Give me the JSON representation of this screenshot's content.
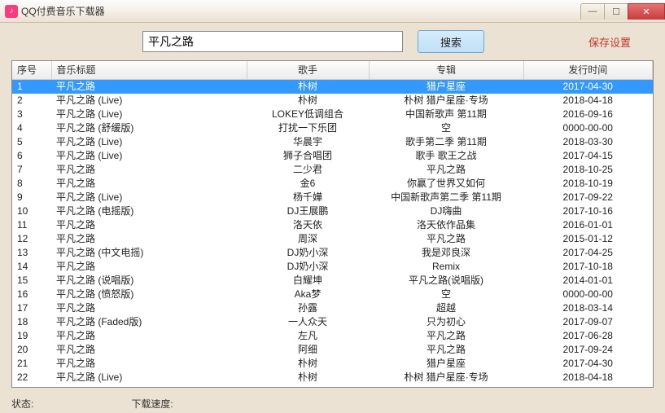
{
  "window": {
    "title": "QQ付费音乐下载器",
    "icon_glyph": "♪"
  },
  "win_controls": {
    "min": "—",
    "max": "☐",
    "close": "✕"
  },
  "search": {
    "value": "平凡之路",
    "button": "搜索",
    "save_link": "保存设置"
  },
  "table": {
    "headers": [
      "序号",
      "音乐标题",
      "歌手",
      "专辑",
      "发行时间"
    ],
    "rows": [
      {
        "n": "1",
        "title": "平凡之路",
        "artist": "朴树",
        "album": "猎户星座",
        "date": "2017-04-30",
        "sel": true
      },
      {
        "n": "2",
        "title": "平凡之路 (Live)",
        "artist": "朴树",
        "album": "朴树 猎户星座·专场",
        "date": "2018-04-18"
      },
      {
        "n": "3",
        "title": "平凡之路 (Live)",
        "artist": "LOKEY低调组合",
        "album": "中国新歌声 第11期",
        "date": "2016-09-16"
      },
      {
        "n": "4",
        "title": "平凡之路 (舒缓版)",
        "artist": "打扰一下乐团",
        "album": "空",
        "date": "0000-00-00"
      },
      {
        "n": "5",
        "title": "平凡之路 (Live)",
        "artist": "华晨宇",
        "album": "歌手第二季 第11期",
        "date": "2018-03-30"
      },
      {
        "n": "6",
        "title": "平凡之路 (Live)",
        "artist": "狮子合唱团",
        "album": "歌手 歌王之战",
        "date": "2017-04-15"
      },
      {
        "n": "7",
        "title": "平凡之路",
        "artist": "二少君",
        "album": "平凡之路",
        "date": "2018-10-25"
      },
      {
        "n": "8",
        "title": "平凡之路",
        "artist": "金6",
        "album": "你赢了世界又如何",
        "date": "2018-10-19"
      },
      {
        "n": "9",
        "title": "平凡之路 (Live)",
        "artist": "杨千嬅",
        "album": "中国新歌声第二季 第11期",
        "date": "2017-09-22"
      },
      {
        "n": "10",
        "title": "平凡之路 (电摇版)",
        "artist": "DJ王展鹏",
        "album": "DJ嗨曲",
        "date": "2017-10-16"
      },
      {
        "n": "11",
        "title": "平凡之路",
        "artist": "洛天依",
        "album": "洛天依作品集",
        "date": "2016-01-01"
      },
      {
        "n": "12",
        "title": "平凡之路",
        "artist": "周深",
        "album": "平凡之路",
        "date": "2015-01-12"
      },
      {
        "n": "13",
        "title": "平凡之路 (中文电摇)",
        "artist": "DJ奶小深",
        "album": "我是邓良深",
        "date": "2017-04-25"
      },
      {
        "n": "14",
        "title": "平凡之路",
        "artist": "DJ奶小深",
        "album": "Remix",
        "date": "2017-10-18"
      },
      {
        "n": "15",
        "title": "平凡之路 (说唱版)",
        "artist": "白耀坤",
        "album": "平凡之路(说唱版)",
        "date": "2014-01-01"
      },
      {
        "n": "16",
        "title": "平凡之路 (愤怒版)",
        "artist": "Aka梦",
        "album": "空",
        "date": "0000-00-00"
      },
      {
        "n": "17",
        "title": "平凡之路",
        "artist": "孙露",
        "album": "超越",
        "date": "2018-03-14"
      },
      {
        "n": "18",
        "title": "平凡之路 (Faded版)",
        "artist": "一人众天",
        "album": "只为初心",
        "date": "2017-09-07"
      },
      {
        "n": "19",
        "title": "平凡之路",
        "artist": "左凡",
        "album": "平凡之路",
        "date": "2017-06-28"
      },
      {
        "n": "20",
        "title": "平凡之路",
        "artist": "阿细",
        "album": "平凡之路",
        "date": "2017-09-24"
      },
      {
        "n": "21",
        "title": "平凡之路",
        "artist": "朴树",
        "album": "猎户星座",
        "date": "2017-04-30"
      },
      {
        "n": "22",
        "title": "平凡之路 (Live)",
        "artist": "朴树",
        "album": "朴树 猎户星座·专场",
        "date": "2018-04-18"
      }
    ]
  },
  "status": {
    "state_label": "状态:",
    "speed_label": "下载速度:"
  }
}
